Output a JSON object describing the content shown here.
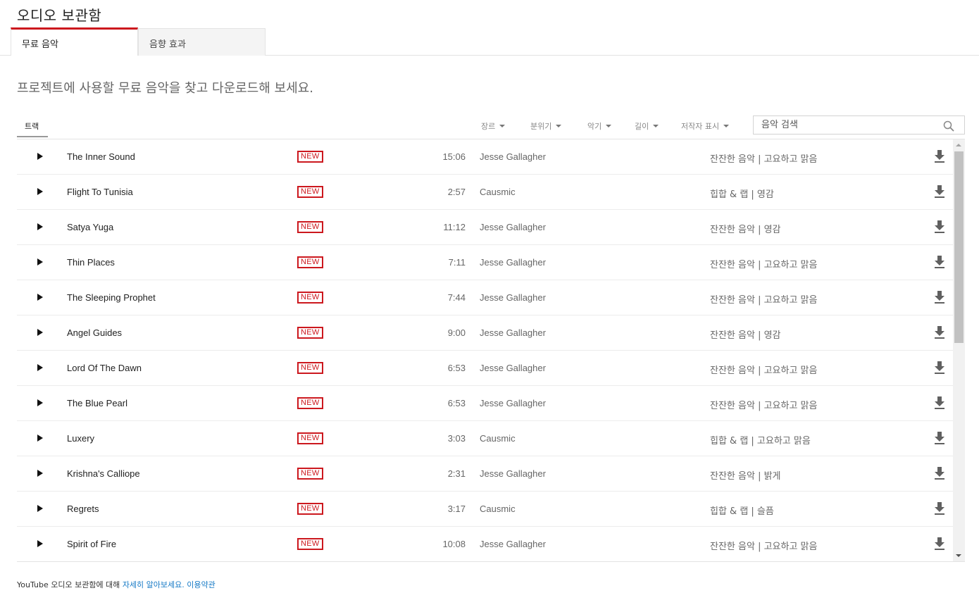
{
  "header": {
    "title": "오디오 보관함"
  },
  "tabs": [
    {
      "label": "무료 음악",
      "active": true
    },
    {
      "label": "음향 효과",
      "active": false
    }
  ],
  "subtitle": "프로젝트에 사용할 무료 음악을 찾고 다운로드해 보세요.",
  "toolbar": {
    "track_tab": "트랙",
    "filters": [
      "장르",
      "분위기",
      "악기",
      "길이",
      "저작자 표시"
    ],
    "search_placeholder": "음악 검색"
  },
  "new_badge": "NEW",
  "tracks": [
    {
      "title": "The Inner Sound",
      "duration": "15:06",
      "artist": "Jesse Gallagher",
      "genre": "잔잔한 음악 | 고요하고 맑음"
    },
    {
      "title": "Flight To Tunisia",
      "duration": "2:57",
      "artist": "Causmic",
      "genre": "힙합 & 랩 | 영감"
    },
    {
      "title": "Satya Yuga",
      "duration": "11:12",
      "artist": "Jesse Gallagher",
      "genre": "잔잔한 음악 | 영감"
    },
    {
      "title": "Thin Places",
      "duration": "7:11",
      "artist": "Jesse Gallagher",
      "genre": "잔잔한 음악 | 고요하고 맑음"
    },
    {
      "title": "The Sleeping Prophet",
      "duration": "7:44",
      "artist": "Jesse Gallagher",
      "genre": "잔잔한 음악 | 고요하고 맑음"
    },
    {
      "title": "Angel Guides",
      "duration": "9:00",
      "artist": "Jesse Gallagher",
      "genre": "잔잔한 음악 | 영감"
    },
    {
      "title": "Lord Of The Dawn",
      "duration": "6:53",
      "artist": "Jesse Gallagher",
      "genre": "잔잔한 음악 | 고요하고 맑음"
    },
    {
      "title": "The Blue Pearl",
      "duration": "6:53",
      "artist": "Jesse Gallagher",
      "genre": "잔잔한 음악 | 고요하고 맑음"
    },
    {
      "title": "Luxery",
      "duration": "3:03",
      "artist": "Causmic",
      "genre": "힙합 & 랩 | 고요하고 맑음"
    },
    {
      "title": "Krishna's Calliope",
      "duration": "2:31",
      "artist": "Jesse Gallagher",
      "genre": "잔잔한 음악 | 밝게"
    },
    {
      "title": "Regrets",
      "duration": "3:17",
      "artist": "Causmic",
      "genre": "힙합 & 랩 | 슬픔"
    },
    {
      "title": "Spirit of Fire",
      "duration": "10:08",
      "artist": "Jesse Gallagher",
      "genre": "잔잔한 음악 | 고요하고 맑음"
    }
  ],
  "footer": {
    "text": "YouTube 오디오 보관함에 대해",
    "learn_more": "자세히 알아보세요.",
    "terms": "이용약관"
  },
  "colors": {
    "accent": "#cc181e",
    "link": "#167ac6"
  }
}
